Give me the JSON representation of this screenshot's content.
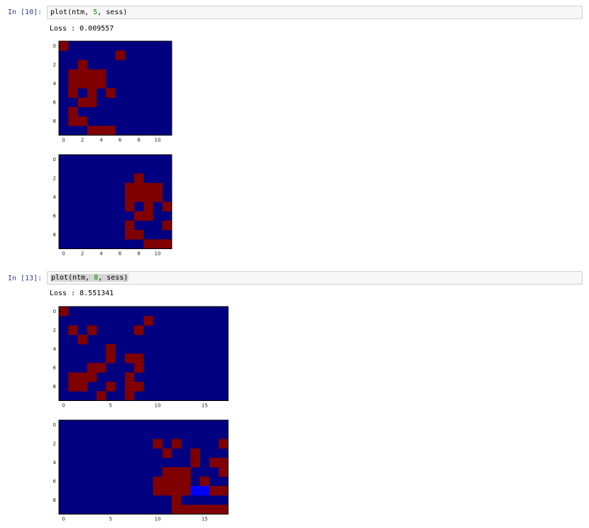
{
  "colors": {
    "background": "#000080",
    "active": "#800000",
    "highlight": "#0000ff"
  },
  "cells": [
    {
      "prompt": "In [10]:",
      "code": {
        "prefix": "plot(ntm, ",
        "arg": "5",
        "suffix": ", sess)"
      },
      "output": "Loss : 0.009557",
      "chart_data": [
        {
          "type": "heatmap",
          "rows": 10,
          "cols": 12,
          "xticks": [
            0,
            2,
            4,
            6,
            8,
            10
          ],
          "yticks": [
            0,
            2,
            4,
            6,
            8
          ],
          "grid": [
            "100000000000",
            "000000100000",
            "001000000000",
            "011110000000",
            "011110000000",
            "010101000000",
            "001100000000",
            "010000000000",
            "011000000000",
            "000111000000"
          ]
        },
        {
          "type": "heatmap",
          "rows": 10,
          "cols": 12,
          "xticks": [
            0,
            2,
            4,
            6,
            8,
            10
          ],
          "yticks": [
            0,
            2,
            4,
            6,
            8
          ],
          "grid": [
            "000000000000",
            "000000000000",
            "000000001000",
            "000000011110",
            "000000011110",
            "000000010101",
            "000000001100",
            "000000010001",
            "000000011000",
            "000000000111"
          ]
        }
      ]
    },
    {
      "prompt": "In [13]:",
      "code": {
        "prefix": "plot(ntm, ",
        "arg": "8",
        "suffix": ", sess)"
      },
      "output": "Loss : 8.551341",
      "chart_data": [
        {
          "type": "heatmap",
          "rows": 10,
          "cols": 18,
          "xticks": [
            0,
            5,
            10,
            15
          ],
          "yticks": [
            0,
            2,
            4,
            6,
            8
          ],
          "grid": [
            "100000000000000000",
            "000000000100000000",
            "010100001000000000",
            "001000000000000000",
            "000001000000000000",
            "000001011000000000",
            "000110001000000000",
            "011100010000000000",
            "011001011000000000",
            "000010010000000000"
          ]
        },
        {
          "type": "heatmap",
          "rows": 10,
          "cols": 18,
          "xticks": [
            0,
            5,
            10,
            15
          ],
          "yticks": [
            0,
            2,
            4,
            6,
            8
          ],
          "grid": [
            "000000000000000000",
            "000000000000000000",
            "000000000010100001",
            "000000000001001000",
            "000000000000001011",
            "000000000001110001",
            "000000000011110100",
            "0000000000111122111",
            "000000000000100000",
            "000000000000111111"
          ]
        }
      ]
    }
  ]
}
